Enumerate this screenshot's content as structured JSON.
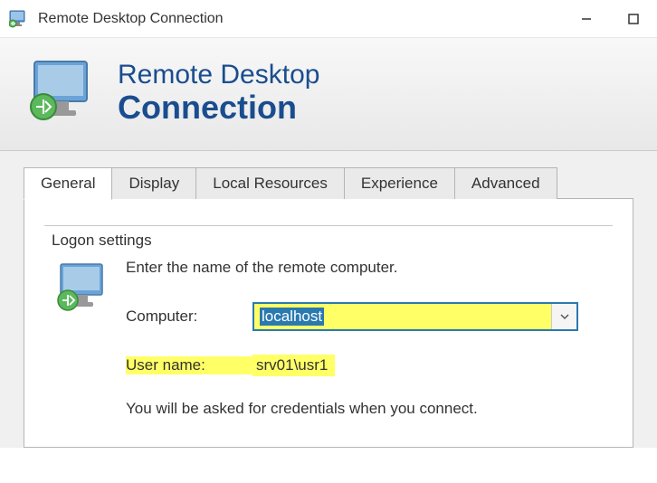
{
  "window": {
    "title": "Remote Desktop Connection"
  },
  "header": {
    "line1": "Remote Desktop",
    "line2": "Connection"
  },
  "tabs": {
    "general": "General",
    "display": "Display",
    "local_resources": "Local Resources",
    "experience": "Experience",
    "advanced": "Advanced"
  },
  "logon": {
    "legend": "Logon settings",
    "instruction": "Enter the name of the remote computer.",
    "computer_label": "Computer:",
    "computer_value": "localhost",
    "username_label": "User name:",
    "username_value": "srv01\\usr1",
    "credentials_note": "You will be asked for credentials when you connect."
  }
}
